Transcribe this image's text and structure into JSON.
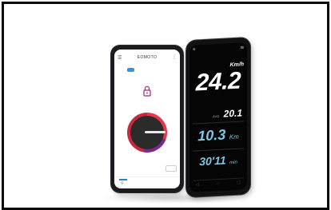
{
  "left_phone": {
    "app_title": "EOMOTO",
    "menu_icon": "hamburger-icon",
    "more_icon": "more-vertical-icon",
    "lock_icon": "lock-icon",
    "accent_color": "#e6364e"
  },
  "right_phone": {
    "speed_unit": "Km/h",
    "speed_value": "24.2",
    "avg_label": "AVG",
    "avg_value": "20.1",
    "distance_value": "10.3",
    "distance_unit": "Km",
    "time_value": "30'11",
    "time_unit": "min",
    "value_color": "#7fc7e8"
  }
}
